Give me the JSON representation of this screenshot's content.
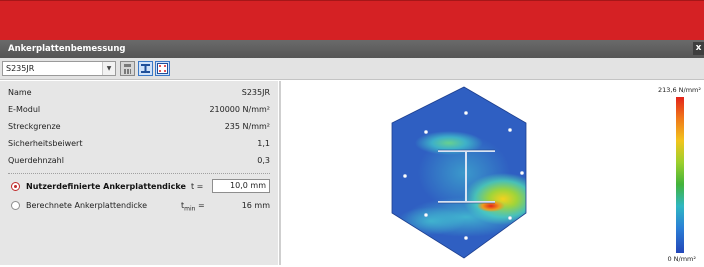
{
  "panel": {
    "title": "Ankerplattenbemessung",
    "close_label": "x"
  },
  "toolbar": {
    "material_selected": "S235JR",
    "dropdown_arrow": "▼"
  },
  "properties": [
    {
      "label": "Name",
      "value": "S235JR"
    },
    {
      "label": "E-Modul",
      "value": "210000 N/mm²"
    },
    {
      "label": "Streckgrenze",
      "value": "235 N/mm²"
    },
    {
      "label": "Sicherheitsbeiwert",
      "value": "1,1"
    },
    {
      "label": "Querdehnzahl",
      "value": "0,3"
    }
  ],
  "options": {
    "custom": {
      "label": "Nutzerdefinierte Ankerplattendicke",
      "symbol": "t =",
      "value": "10,0 mm",
      "selected": true
    },
    "computed": {
      "label": "Berechnete Ankerplattendicke",
      "symbol_main": "t",
      "symbol_sub": "min",
      "symbol_eq": " =",
      "value": "16 mm",
      "selected": false
    }
  },
  "legend": {
    "max_label": "213,6 N/mm²",
    "min_label": "0 N/mm²"
  },
  "colors": {
    "accent_red": "#d52124",
    "titlebar": "#5e5e5e",
    "panel_bg": "#e6e6e6",
    "plate_blue": "#2f5fc2"
  },
  "icons": [
    "calculator-icon",
    "i-beam-icon",
    "anchor-plate-icon",
    "close-icon",
    "chevron-down-icon"
  ]
}
